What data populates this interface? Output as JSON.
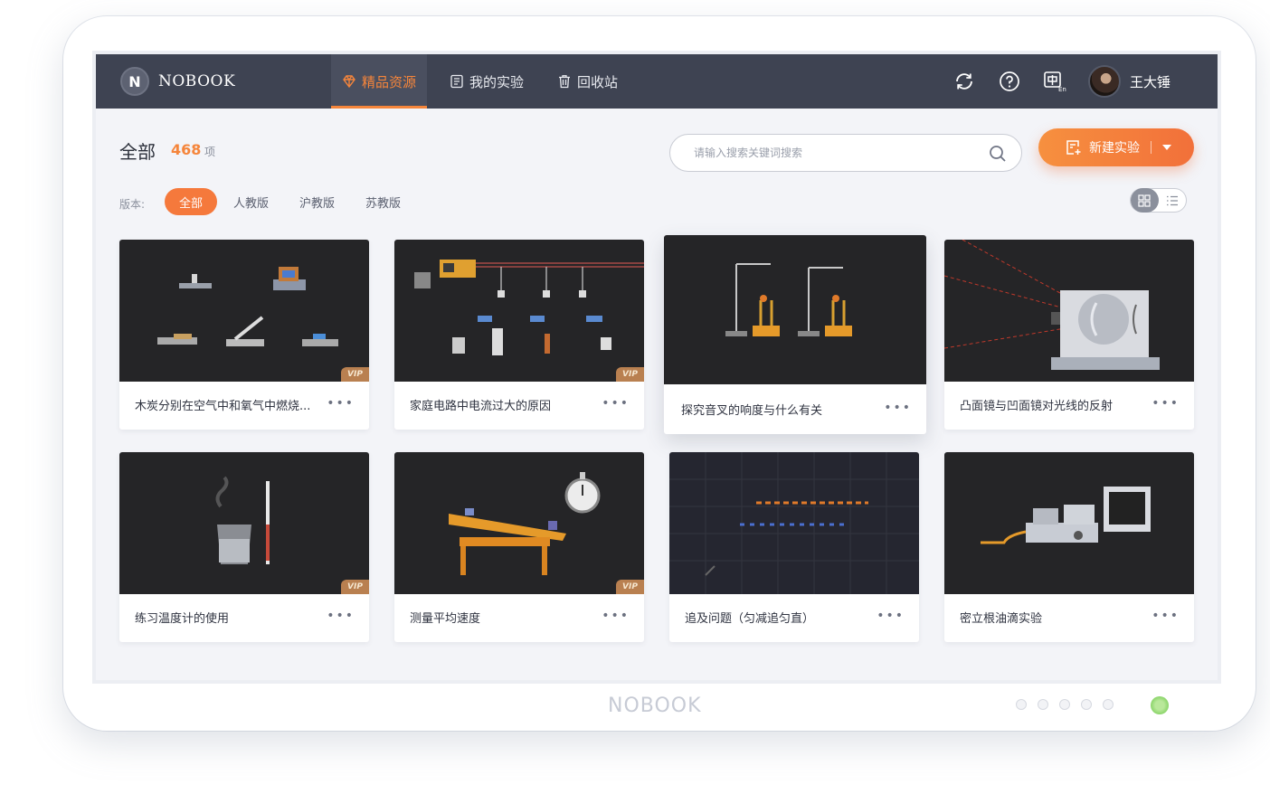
{
  "app": {
    "logo_letter": "N",
    "logo_text": "NOBOOK"
  },
  "nav": {
    "items": [
      {
        "label": "精品资源",
        "icon": "gem-icon",
        "active": true
      },
      {
        "label": "我的实验",
        "icon": "list-doc-icon",
        "active": false
      },
      {
        "label": "回收站",
        "icon": "trash-icon",
        "active": false
      }
    ]
  },
  "toolbar": {
    "icons": [
      "sync-icon",
      "help-icon",
      "language-icon"
    ]
  },
  "user": {
    "name": "王大锤"
  },
  "header": {
    "title": "全部",
    "count": "468",
    "count_unit": "项"
  },
  "search": {
    "placeholder": "请输入搜索关键词搜索"
  },
  "new_button": {
    "label": "新建实验"
  },
  "filter": {
    "label": "版本:",
    "options": [
      "全部",
      "人教版",
      "沪教版",
      "苏教版"
    ],
    "selected": "全部"
  },
  "view": {
    "selected": "grid"
  },
  "cards": [
    {
      "title": "木炭分别在空气中和氧气中燃烧...",
      "vip": "VIP"
    },
    {
      "title": "家庭电路中电流过大的原因",
      "vip": "VIP"
    },
    {
      "title": "探究音叉的响度与什么有关",
      "vip": ""
    },
    {
      "title": "凸面镜与凹面镜对光线的反射",
      "vip": ""
    },
    {
      "title": "练习温度计的使用",
      "vip": "VIP"
    },
    {
      "title": "测量平均速度",
      "vip": "VIP"
    },
    {
      "title": "追及问题（匀减追匀直）",
      "vip": ""
    },
    {
      "title": "密立根油滴实验",
      "vip": ""
    }
  ],
  "card_more": "•••",
  "bezel": {
    "brand": "NOBOOK"
  },
  "colors": {
    "accent": "#f5853b",
    "topbar": "#3e4352",
    "vip": "#b98050"
  }
}
